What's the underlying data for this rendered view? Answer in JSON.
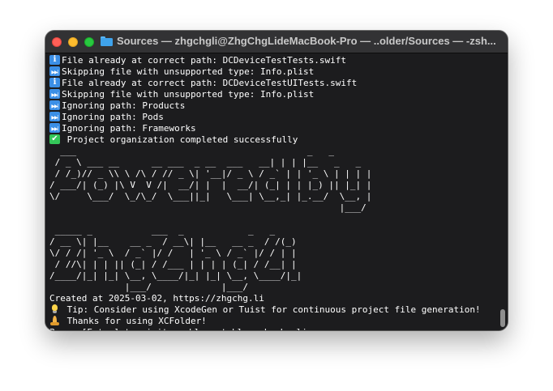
{
  "window": {
    "title": "Sources — zhgchgli@ZhgChgLideMacBook-Pro — ..older/Sources — -zsh..."
  },
  "log_lines": [
    {
      "icon": "info",
      "text": "File already at correct path: DCDeviceTestTests.swift"
    },
    {
      "icon": "skip",
      "text": "Skipping file with unsupported type: Info.plist"
    },
    {
      "icon": "info",
      "text": "File already at correct path: DCDeviceTestUITests.swift"
    },
    {
      "icon": "skip",
      "text": "Skipping file with unsupported type: Info.plist"
    },
    {
      "icon": "skip",
      "text": "Ignoring path: Products"
    },
    {
      "icon": "skip",
      "text": "Ignoring path: Pods"
    },
    {
      "icon": "skip",
      "text": "Ignoring path: Frameworks"
    },
    {
      "icon": "check",
      "text": " Project organization completed successfully"
    }
  ],
  "ascii_powered_by": [
    "  ___                                           _   _           ",
    " / _ \\ ___ __      __ ___  _ __  ___   __| | | |__   _   _ ",
    " / /_)// _ \\\\ \\ /\\ / // _ \\| '__|/ _ \\ / _` | | '_ \\ | | | |",
    "/ ___/| (_) |\\ V  V /|  __/| |  |  __/| (_| | | |_) || |_| |",
    "\\/     \\___/  \\_/\\_/  \\___||_|   \\___| \\__,_| |_.__/  \\__, |",
    "                                                      |___/ "
  ],
  "ascii_xcfolder": [
    " _____ _           ___  _            _   _ ",
    "/ __ \\| |__    __ _  / __\\| |__   __ _  / /(_)",
    "\\/ / /| '_ \\  / _` |/ /   | '_ \\ / _` |/ / | |",
    " / //\\| | | || (_| / /___ | | | | (_| / /__| |",
    "/____/|_| |_| \\__, \\____/|_| |_| \\__, \\____/|_|",
    "              |___/             |___/        "
  ],
  "footer_lines": [
    {
      "icon": "",
      "text": "Created at 2025-03-02, https://zhgchg.li"
    },
    {
      "icon": "bulb",
      "text": " Tip: Consider using XcodeGen or Tuist for continuous project file generation!"
    },
    {
      "icon": "pray",
      "text": " Thanks for using XCFolder!"
    },
    {
      "icon": "",
      "text": "Press [Enter] to visit my blog at blog.zhgchg.li..."
    }
  ]
}
